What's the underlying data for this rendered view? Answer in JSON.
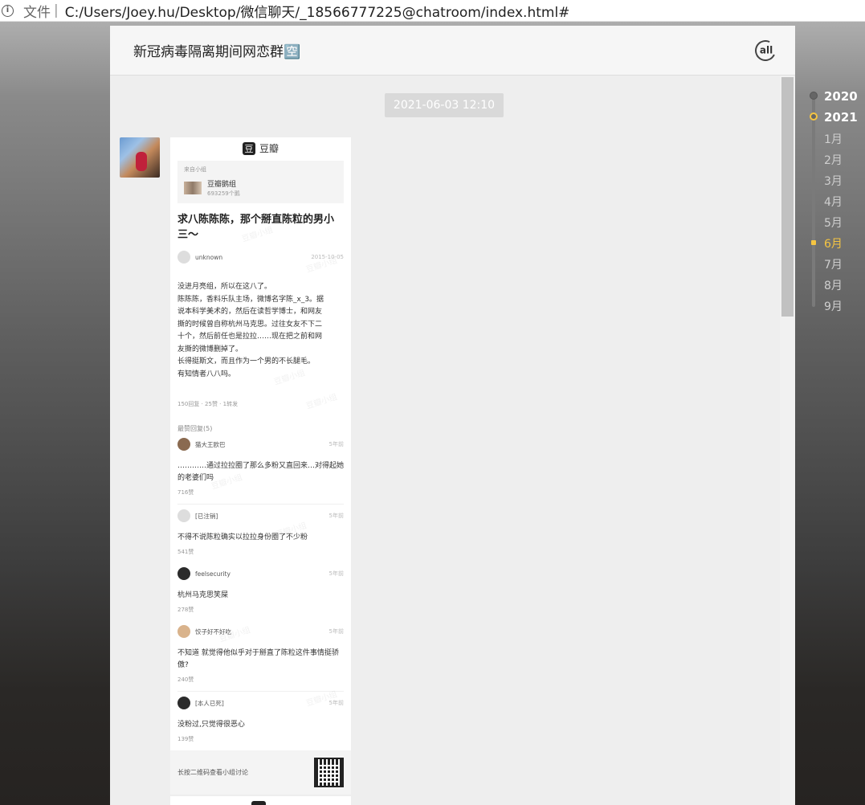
{
  "browser": {
    "scheme_label": "文件",
    "separator": "|",
    "url": "C:/Users/Joey.hu/Desktop/微信聊天/_18566777225@chatroom/index.html#"
  },
  "chat": {
    "title": "新冠病毒隔离期间网恋群🈳",
    "at_all_label": "all",
    "timestamp": "2021-06-03 12:10"
  },
  "card": {
    "brand": "豆瓣",
    "brand_logo_char": "豆",
    "from_label": "来自小组",
    "group_name": "豆瓣鹅组",
    "group_count": "693259个鹅",
    "post_title": "求八陈陈陈，那个掰直陈粒的男小三～",
    "author": "unknown",
    "post_date": "2015-10-05",
    "body_lines": [
      "没进月亮组，所以在这八了。",
      "陈陈陈，香料乐队主场，微博名字陈_x_3。据",
      "说本科学美术的，然后在读哲学博士，和网友",
      "撕的时候曾自称杭州马克思。过往女友不下二",
      "十个，然后前任也是拉拉……现在把之前和网",
      "友撕的微博删掉了。",
      "长得挺斯文，而且作为一个男的不长腿毛。",
      "有知情者八八吗。"
    ],
    "stats": "150回复 · 25赞 · 1转发",
    "best_label": "最赞回复(5)",
    "replies": [
      {
        "name": "猫大王欧巴",
        "time": "5年前",
        "text": "…………通过拉拉圈了那么多粉又直回来…对得起她的老婆们吗",
        "likes": "716赞"
      },
      {
        "name": "[已注销]",
        "time": "5年前",
        "text": "不得不说陈粒确实以拉拉身份圈了不少粉",
        "likes": "541赞"
      },
      {
        "name": "feelsecurity",
        "time": "5年前",
        "text": "杭州马克思笑屎",
        "likes": "278赞"
      },
      {
        "name": "饺子好不好吃",
        "time": "5年前",
        "text": "不知道 就觉得他似乎对于掰直了陈粒这件事情挺骄傲?",
        "likes": "240赞"
      },
      {
        "name": "[本人已死]",
        "time": "5年前",
        "text": "没粉过,只觉得很恶心",
        "likes": "139赞"
      }
    ],
    "footer_text": "长按二维码查看小组讨论",
    "watermark": "豆瓣小组"
  },
  "timeline": {
    "years": [
      "2020",
      "2021"
    ],
    "months": [
      "1月",
      "2月",
      "3月",
      "4月",
      "5月",
      "6月",
      "7月",
      "8月",
      "9月"
    ],
    "active_year": "2021",
    "active_month": "6月",
    "active_color": "#f5c542"
  }
}
